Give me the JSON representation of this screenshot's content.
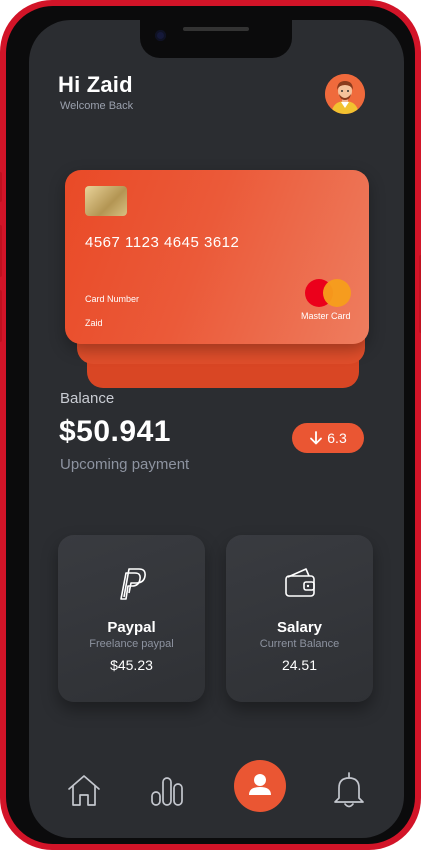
{
  "header": {
    "greeting": "Hi Zaid",
    "subtitle": "Welcome Back",
    "avatar_icon": "user-avatar"
  },
  "card": {
    "number": "4567 1123 4645 3612",
    "number_label": "Card Number",
    "holder": "Zaid",
    "brand": "Master Card",
    "colors": {
      "primary": "#e94a27",
      "secondary": "#ee7d5f"
    }
  },
  "balance": {
    "label": "Balance",
    "amount": "$50.941",
    "upcoming": "Upcoming payment",
    "change": "6.3",
    "change_icon": "arrow-down-icon"
  },
  "tiles": [
    {
      "title": "Paypal",
      "subtitle": "Freelance paypal",
      "value": "$45.23",
      "icon": "paypal-icon"
    },
    {
      "title": "Salary",
      "subtitle": "Current Balance",
      "value": "24.51",
      "icon": "wallet-icon"
    }
  ],
  "nav": {
    "items": [
      {
        "icon": "home-icon"
      },
      {
        "icon": "chart-icon"
      },
      {
        "icon": "profile-icon",
        "active": true
      },
      {
        "icon": "bell-icon"
      }
    ],
    "accent": "#ea5633"
  }
}
